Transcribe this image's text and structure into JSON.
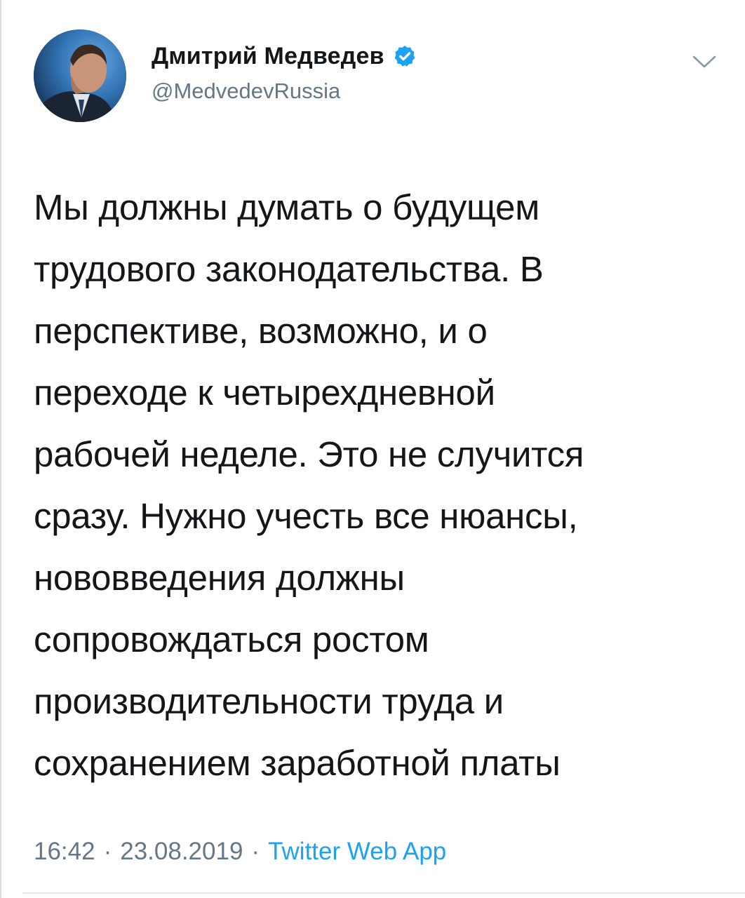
{
  "header": {
    "display_name": "Дмитрий Медведев",
    "handle": "@MedvedevRussia",
    "verified": true,
    "avatar_icon": "avatar-photo",
    "verified_icon": "verified-badge-icon",
    "menu_icon": "chevron-down-icon"
  },
  "tweet": {
    "lines": [
      "Мы должны думать о будущем",
      "трудового законодательства. В",
      "перспективе, возможно, и о",
      "переходе к четырехдневной",
      "рабочей неделе. Это не случится",
      "сразу. Нужно учесть все нюансы,",
      "нововведения должны",
      "сопровождаться ростом",
      "производительности труда и",
      "сохранением заработной платы"
    ]
  },
  "meta": {
    "time": "16:42",
    "separator": "·",
    "date": "23.08.2019",
    "source": "Twitter Web App"
  },
  "colors": {
    "text": "#14171a",
    "secondary": "#657786",
    "accent": "#1da1f2"
  }
}
